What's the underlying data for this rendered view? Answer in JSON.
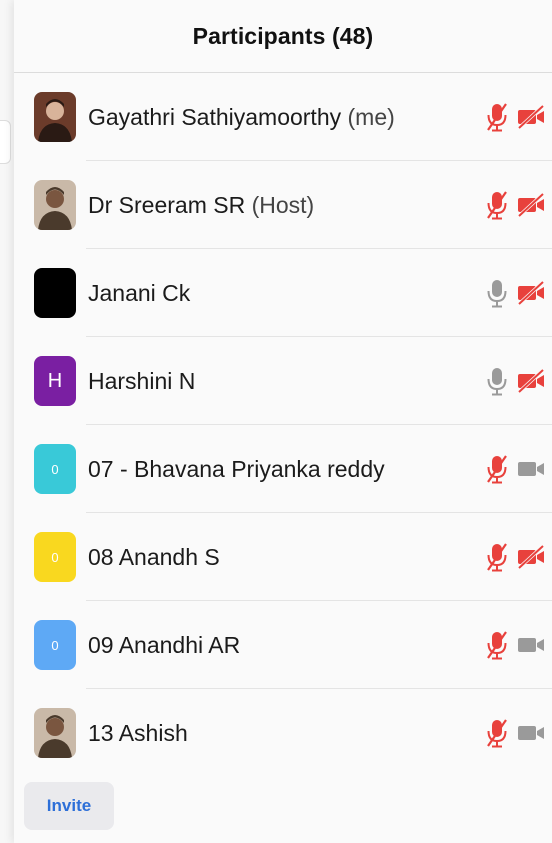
{
  "header": {
    "title": "Participants (48)"
  },
  "participants": [
    {
      "name": "Gayathri Sathiyamoorthy",
      "role": "(me)",
      "avatar": {
        "type": "photo",
        "icon": "photo-avatar"
      },
      "mic": "muted",
      "video": "off"
    },
    {
      "name": "Dr Sreeram SR",
      "role": "(Host)",
      "avatar": {
        "type": "photo",
        "icon": "photo-avatar"
      },
      "mic": "muted",
      "video": "off"
    },
    {
      "name": "Janani Ck",
      "role": "",
      "avatar": {
        "type": "color",
        "color": "#000000",
        "letter": ""
      },
      "mic": "unmuted",
      "video": "off"
    },
    {
      "name": "Harshini N",
      "role": "",
      "avatar": {
        "type": "color",
        "color": "#7a1fa2",
        "letter": "H"
      },
      "mic": "unmuted",
      "video": "off"
    },
    {
      "name": "07 - Bhavana Priyanka reddy",
      "role": "",
      "avatar": {
        "type": "color",
        "color": "#39c9d8",
        "letter": "0"
      },
      "mic": "muted",
      "video": "on"
    },
    {
      "name": "08 Anandh S",
      "role": "",
      "avatar": {
        "type": "color",
        "color": "#f9d81f",
        "letter": "0"
      },
      "mic": "muted",
      "video": "off"
    },
    {
      "name": "09 Anandhi AR",
      "role": "",
      "avatar": {
        "type": "color",
        "color": "#5ea9f5",
        "letter": "0"
      },
      "mic": "muted",
      "video": "on"
    },
    {
      "name": "13 Ashish",
      "role": "",
      "avatar": {
        "type": "photo",
        "icon": "photo-avatar"
      },
      "mic": "muted",
      "video": "on"
    }
  ],
  "footer": {
    "invite_label": "Invite"
  },
  "colors": {
    "muted_red": "#e8413c",
    "neutral_gray": "#9a9a9a",
    "accent_blue": "#2d6fd8"
  }
}
